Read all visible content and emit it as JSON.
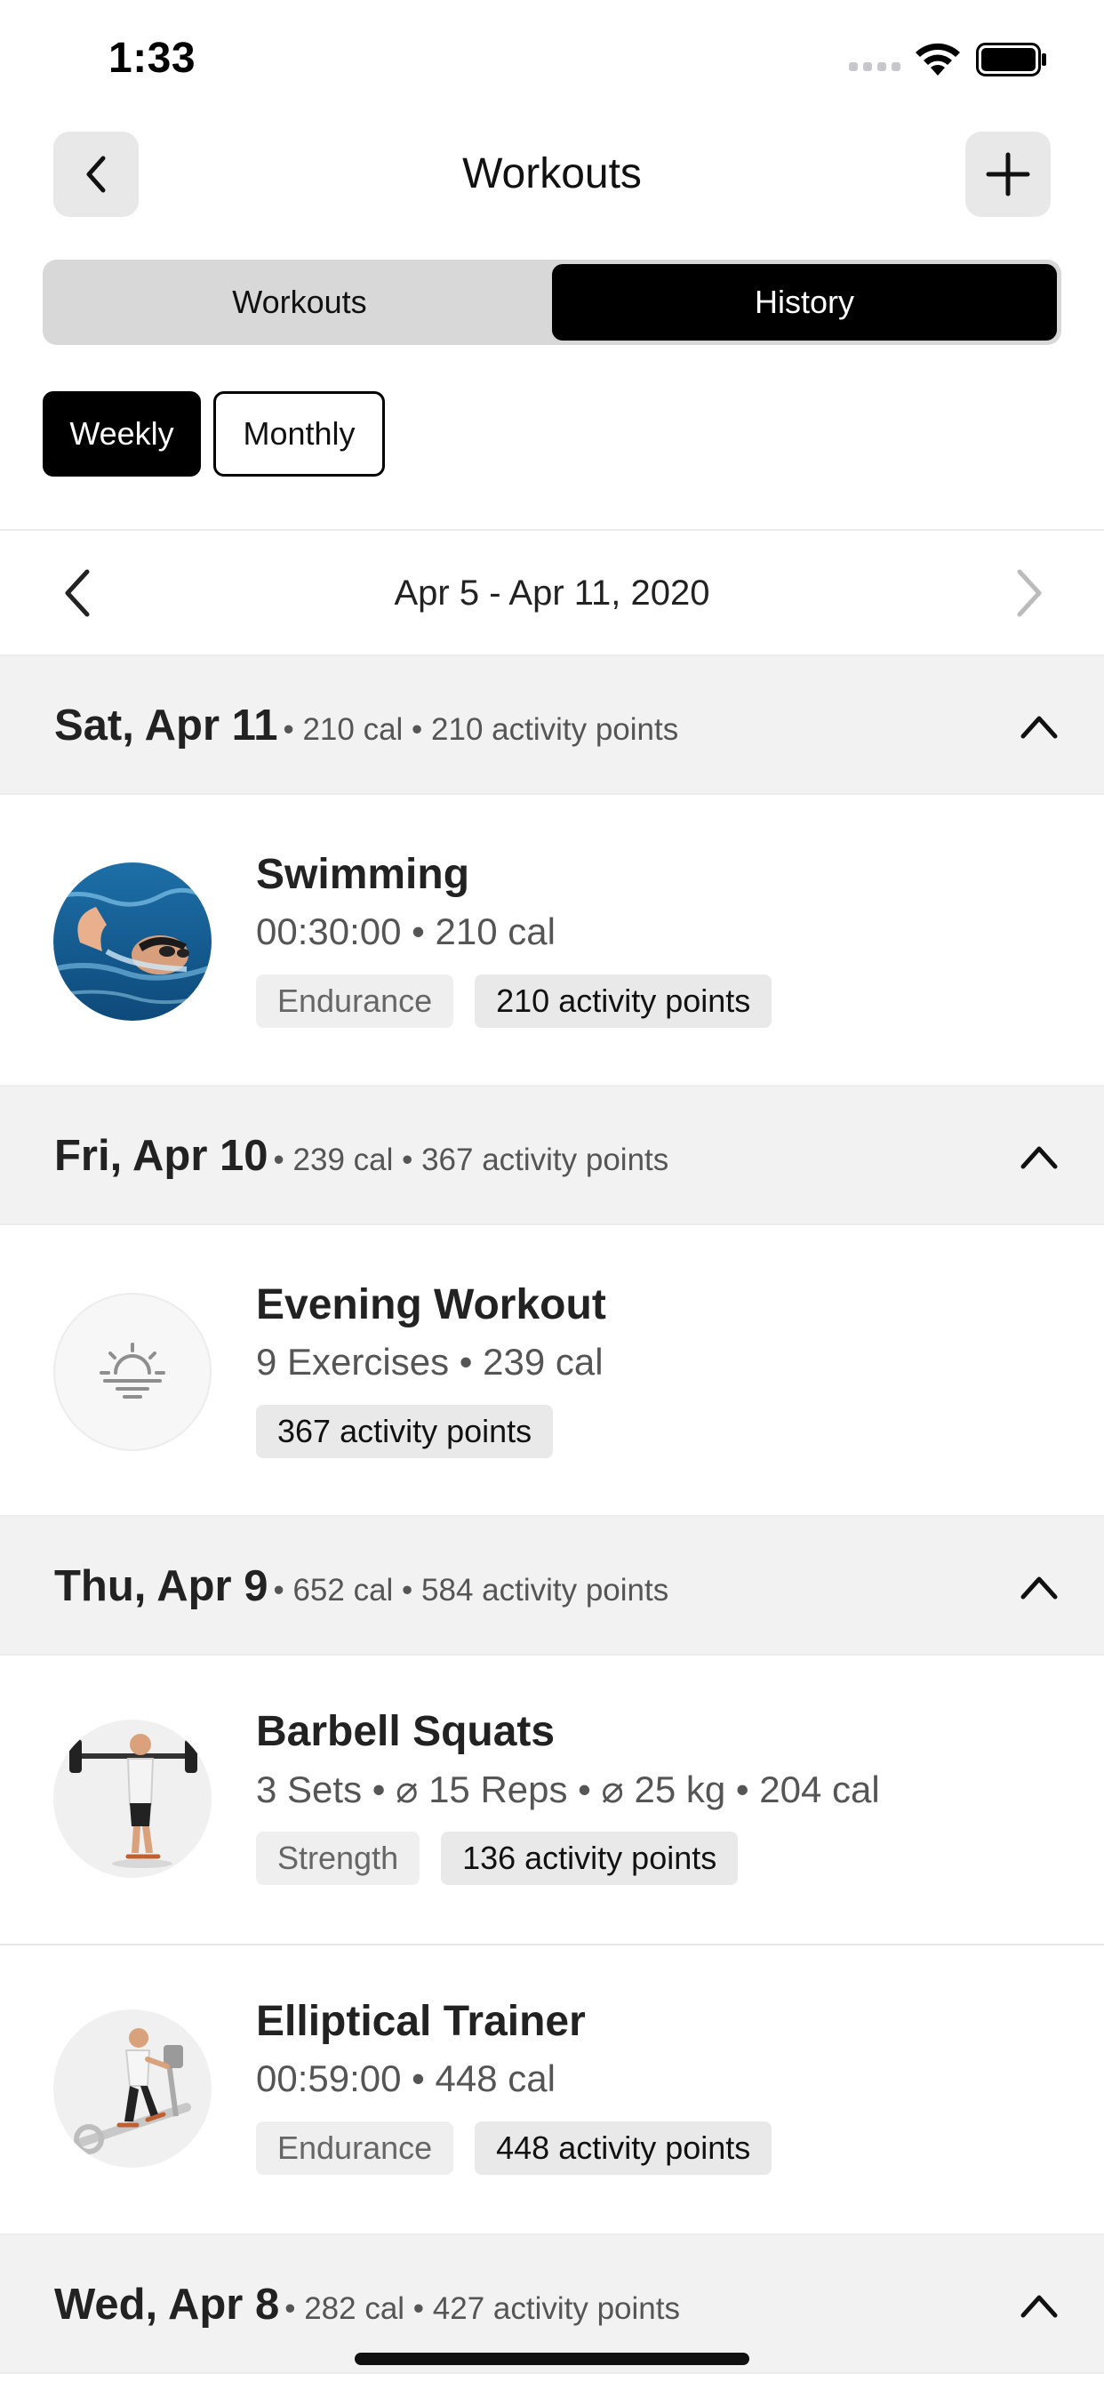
{
  "status_bar": {
    "time": "1:33"
  },
  "header": {
    "title": "Workouts"
  },
  "tabs": [
    {
      "label": "Workouts",
      "active": false
    },
    {
      "label": "History",
      "active": true
    }
  ],
  "period": {
    "weekly": "Weekly",
    "monthly": "Monthly",
    "selected": "Weekly"
  },
  "range": {
    "label": "Apr 5 - Apr 11, 2020"
  },
  "days": [
    {
      "title": "Sat, Apr 11",
      "meta": "• 210 cal • 210 activity points",
      "workouts": [
        {
          "name": "Swimming",
          "detail": "00:30:00 • 210 cal",
          "category": "Endurance",
          "points": "210 activity points",
          "icon": "swimmer-photo"
        }
      ]
    },
    {
      "title": "Fri, Apr 10",
      "meta": "• 239 cal • 367 activity points",
      "workouts": [
        {
          "name": "Evening Workout",
          "detail": "9 Exercises • 239 cal",
          "category": "",
          "points": "367 activity points",
          "icon": "sunset-icon"
        }
      ]
    },
    {
      "title": "Thu, Apr 9",
      "meta": "• 652 cal • 584 activity points",
      "workouts": [
        {
          "name": "Barbell Squats",
          "detail": "3 Sets • ⌀ 15 Reps • ⌀ 25 kg • 204 cal",
          "category": "Strength",
          "points": "136 activity points",
          "icon": "barbell-figure"
        },
        {
          "name": "Elliptical Trainer",
          "detail": "00:59:00 • 448 cal",
          "category": "Endurance",
          "points": "448 activity points",
          "icon": "elliptical-figure"
        }
      ]
    },
    {
      "title": "Wed, Apr 8",
      "meta": "• 282 cal • 427 activity points",
      "workouts": []
    }
  ]
}
